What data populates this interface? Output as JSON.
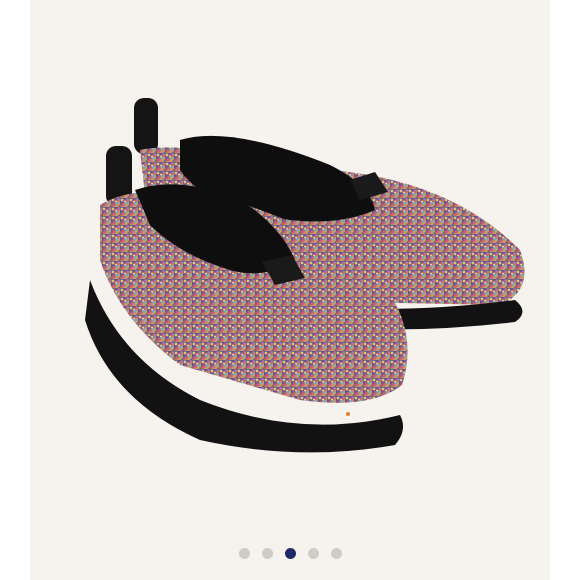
{
  "gallery": {
    "slide_count": 5,
    "active_index": 2,
    "colors": {
      "background": "#f6f3ee",
      "dot_inactive": "#cfccc8",
      "dot_active": "#1f2a6b"
    },
    "image_icon": "product-photo"
  }
}
